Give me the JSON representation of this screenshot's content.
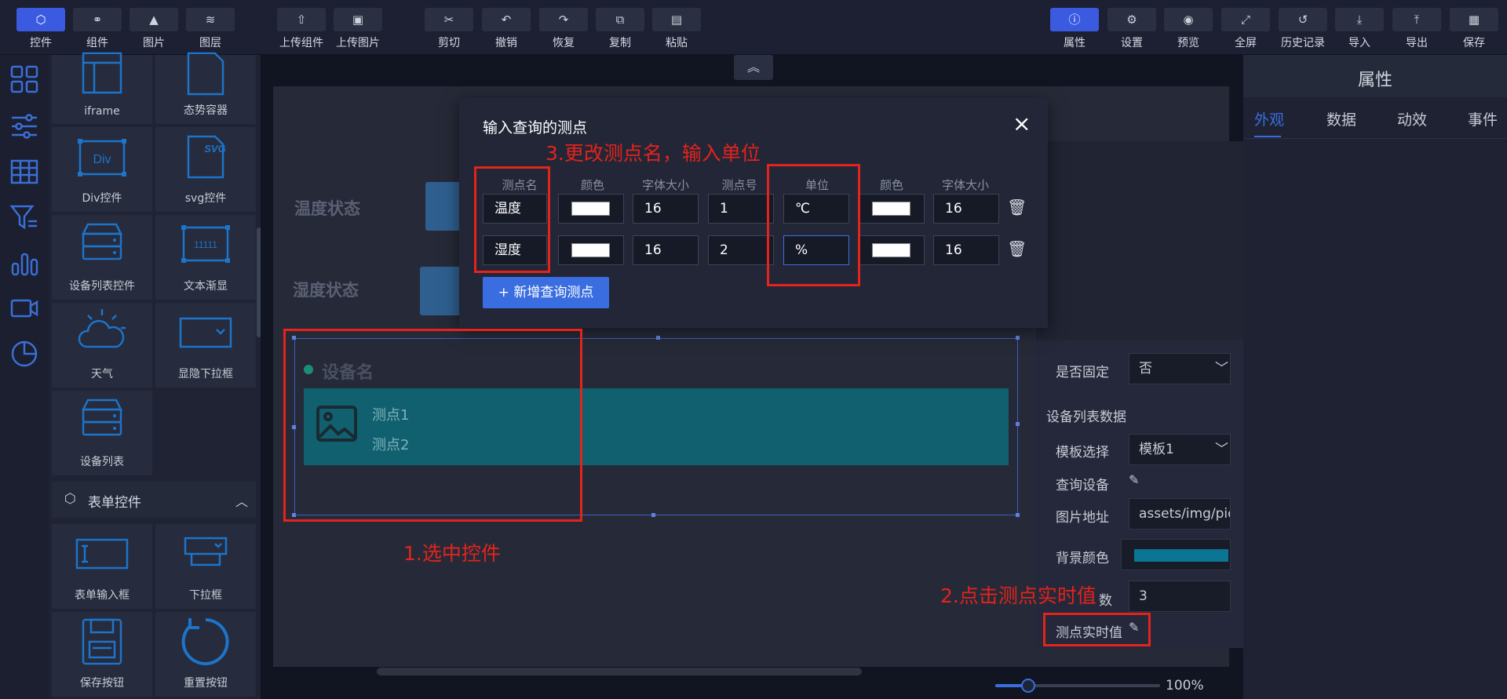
{
  "toolbar": {
    "left": [
      {
        "label": "控件",
        "icon": "cube-icon",
        "active": true
      },
      {
        "label": "组件",
        "icon": "link-icon"
      },
      {
        "label": "图片",
        "icon": "image-icon"
      },
      {
        "label": "图层",
        "icon": "layers-icon"
      },
      {
        "label": "上传组件",
        "icon": "upload-component-icon"
      },
      {
        "label": "上传图片",
        "icon": "upload-image-icon"
      },
      {
        "label": "剪切",
        "icon": "cut-icon"
      },
      {
        "label": "撤销",
        "icon": "undo-icon"
      },
      {
        "label": "恢复",
        "icon": "redo-icon"
      },
      {
        "label": "复制",
        "icon": "copy-icon"
      },
      {
        "label": "粘贴",
        "icon": "paste-icon"
      }
    ],
    "right": [
      {
        "label": "属性",
        "icon": "info-icon",
        "active": true
      },
      {
        "label": "设置",
        "icon": "gear-icon"
      },
      {
        "label": "预览",
        "icon": "eye-icon"
      },
      {
        "label": "全屏",
        "icon": "fullscreen-icon"
      },
      {
        "label": "历史记录",
        "icon": "history-icon"
      },
      {
        "label": "导入",
        "icon": "import-icon"
      },
      {
        "label": "导出",
        "icon": "export-icon"
      },
      {
        "label": "保存",
        "icon": "save-icon"
      }
    ]
  },
  "components": [
    {
      "label": "iframe",
      "icon": "iframe-icon"
    },
    {
      "label": "态势容器",
      "icon": "document-icon"
    },
    {
      "label": "Div控件",
      "icon": "div-icon",
      "icon_text": "Div"
    },
    {
      "label": "svg控件",
      "icon": "svg-icon",
      "icon_text": "SVG"
    },
    {
      "label": "设备列表控件",
      "icon": "device-list-icon"
    },
    {
      "label": "文本渐显",
      "icon": "text-fade-icon",
      "icon_text": "11111"
    },
    {
      "label": "天气",
      "icon": "weather-icon"
    },
    {
      "label": "显隐下拉框",
      "icon": "dropdown-icon"
    },
    {
      "label": "设备列表",
      "icon": "device-list-icon"
    }
  ],
  "form_section": {
    "title": "表单控件",
    "items": [
      {
        "label": "表单输入框",
        "icon": "input-box-icon"
      },
      {
        "label": "下拉框",
        "icon": "select-icon"
      },
      {
        "label": "保存按钮",
        "icon": "floppy-icon"
      },
      {
        "label": "重置按钮",
        "icon": "reset-icon"
      }
    ]
  },
  "canvas": {
    "row1_label": "温度状态",
    "row2_label": "湿度状态",
    "device_title": "设备名",
    "point1": "测点1",
    "point2": "测点2"
  },
  "modal": {
    "title": "输入查询的测点",
    "close": "×",
    "headers": [
      "测点名",
      "颜色",
      "字体大小",
      "测点号",
      "单位",
      "颜色",
      "字体大小"
    ],
    "rows": [
      {
        "name": "温度",
        "size": "16",
        "num": "1",
        "unit": "℃",
        "size2": "16"
      },
      {
        "name": "湿度",
        "size": "16",
        "num": "2",
        "unit": "%",
        "size2": "16"
      }
    ],
    "add_button": "+ 新增查询测点"
  },
  "props": {
    "title": "属性",
    "tabs": [
      "外观",
      "数据",
      "动效",
      "事件"
    ],
    "fixed_label": "是否固定",
    "fixed_value": "否",
    "section": "设备列表数据",
    "template_label": "模板选择",
    "template_value": "模板1",
    "query_label": "查询设备",
    "image_label": "图片地址",
    "image_value": "assets/img/pict",
    "bg_label": "背景颜色",
    "count_label": "数",
    "count_value": "3",
    "realtime_label": "测点实时值"
  },
  "annotations": {
    "step1": "1.选中控件",
    "step2": "2.点击测点实时值",
    "step3": "3.更改测点名，输入单位"
  },
  "zoom": {
    "value": "100%",
    "level": 0.2
  },
  "colors": {
    "accent": "#3a5ae0",
    "device_bar": "#11606f",
    "annotation": "#e4231b",
    "bg_color_swatch": "#0b7593"
  }
}
